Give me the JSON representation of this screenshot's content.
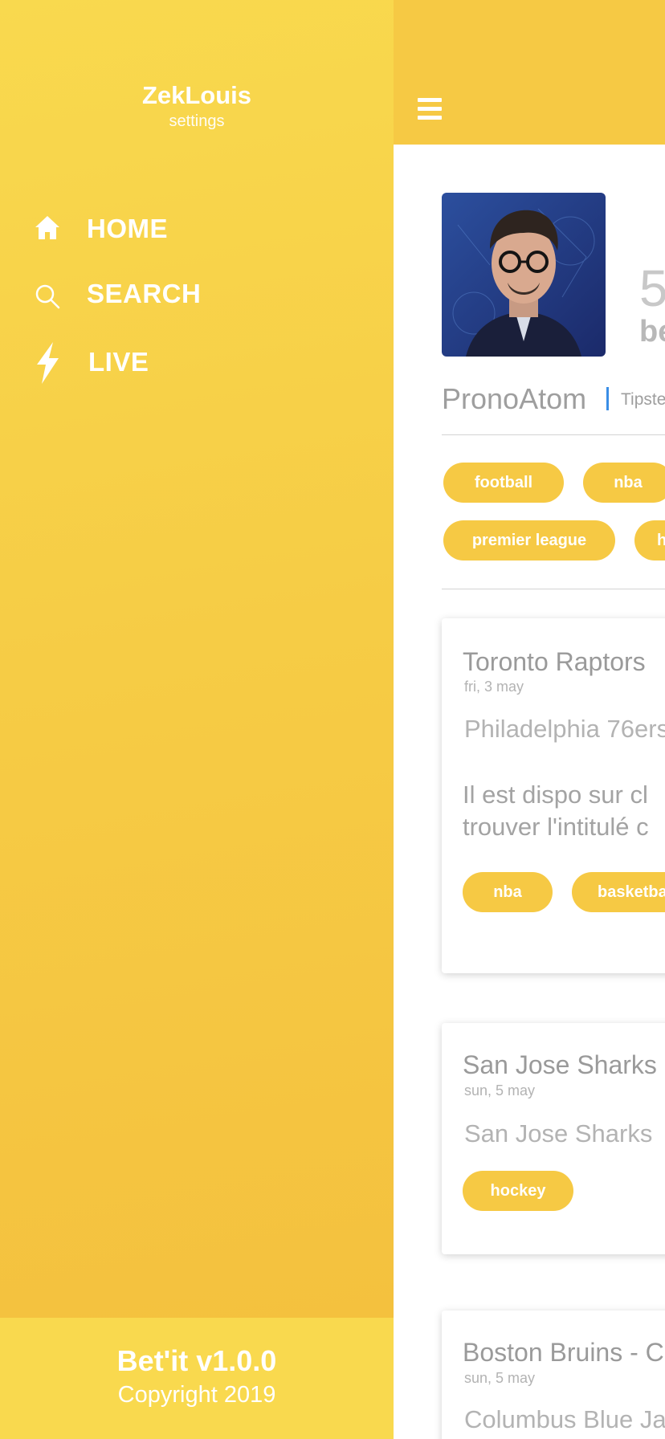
{
  "sidebar": {
    "user_name": "ZekLouis",
    "user_subtitle": "settings",
    "nav": [
      {
        "label": "HOME",
        "icon": "home-icon"
      },
      {
        "label": "SEARCH",
        "icon": "search-icon"
      },
      {
        "label": "LIVE",
        "icon": "lightning-icon"
      }
    ],
    "footer": {
      "title": "Bet'it v1.0.0",
      "copyright": "Copyright 2019"
    }
  },
  "header": {
    "menu_icon": "hamburger-icon"
  },
  "profile": {
    "stat_number": "5",
    "stat_label": "be",
    "name": "PronoAtom",
    "role": "Tipste",
    "tags": [
      "football",
      "nba",
      "premier league",
      "h"
    ]
  },
  "posts": [
    {
      "title": "Toronto Raptors",
      "date": "fri, 3 may",
      "team": "Philadelphia 76ers",
      "description_lines": [
        "Il est dispo sur cl",
        "trouver l'intitulé c"
      ],
      "tags": [
        "nba",
        "basketba"
      ]
    },
    {
      "title": "San Jose Sharks",
      "date": "sun, 5 may",
      "team": "San Jose Sharks",
      "tags": [
        "hockey"
      ]
    },
    {
      "title": "Boston Bruins - C",
      "date": "sun, 5 may",
      "team": "Columbus Blue Ja"
    }
  ],
  "colors": {
    "accent": "#f6c944",
    "sidebar_top": "#f9d94e",
    "sidebar_bottom": "#f4bf3d",
    "separator": "#3a8ee6"
  }
}
